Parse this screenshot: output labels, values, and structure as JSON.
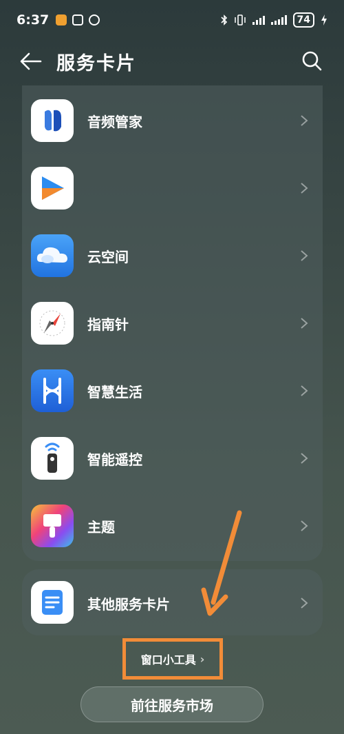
{
  "status_bar": {
    "time": "6:37",
    "battery": "74",
    "icons": [
      "app-notification-icon",
      "nfc-icon",
      "alarm-icon",
      "bluetooth-icon",
      "vibrate-icon",
      "signal-icon",
      "signal-icon",
      "battery-icon",
      "charging-icon"
    ]
  },
  "app_bar": {
    "title": "服务卡片"
  },
  "cards": [
    {
      "label": "音频管家",
      "icon": "audio-manager-icon"
    },
    {
      "label": "",
      "icon": "video-play-icon"
    },
    {
      "label": "云空间",
      "icon": "cloud-icon"
    },
    {
      "label": "指南针",
      "icon": "compass-icon"
    },
    {
      "label": "智慧生活",
      "icon": "smart-life-icon"
    },
    {
      "label": "智能遥控",
      "icon": "remote-control-icon"
    },
    {
      "label": "主题",
      "icon": "theme-brush-icon"
    }
  ],
  "other_card": {
    "label": "其他服务卡片",
    "icon": "document-icon"
  },
  "widget_link": {
    "label": "窗口小工具"
  },
  "market_button": {
    "label": "前往服务市场"
  },
  "colors": {
    "annotation": "#f28c38",
    "background": "#3a4845"
  }
}
